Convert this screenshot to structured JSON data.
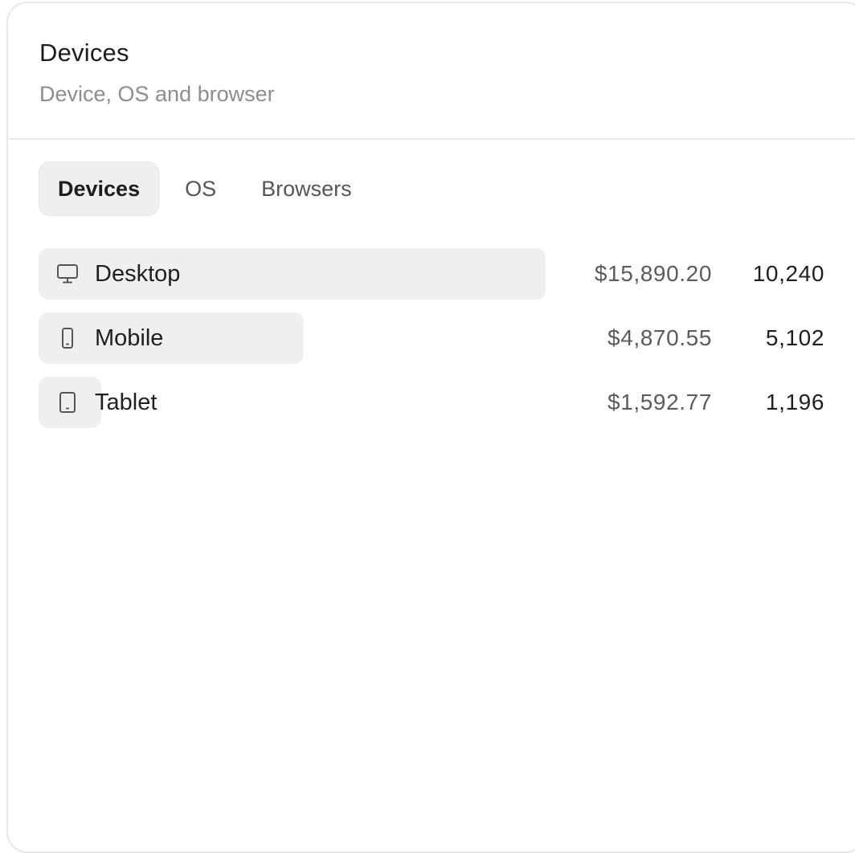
{
  "card": {
    "title": "Devices",
    "subtitle": "Device, OS and browser"
  },
  "tabs": [
    {
      "label": "Devices",
      "active": true
    },
    {
      "label": "OS",
      "active": false
    },
    {
      "label": "Browsers",
      "active": false
    }
  ],
  "rows": [
    {
      "icon": "desktop-icon",
      "label": "Desktop",
      "amount": "$15,890.20",
      "count": "10,240",
      "share": 0.645
    },
    {
      "icon": "mobile-icon",
      "label": "Mobile",
      "amount": "$4,870.55",
      "count": "5,102",
      "share": 0.337
    },
    {
      "icon": "tablet-icon",
      "label": "Tablet",
      "amount": "$1,592.77",
      "count": "1,196",
      "share": 0.08
    }
  ],
  "colors": {
    "bar": "#efefed",
    "border": "#e7e7e5",
    "subtitle": "#8d8d8d"
  }
}
